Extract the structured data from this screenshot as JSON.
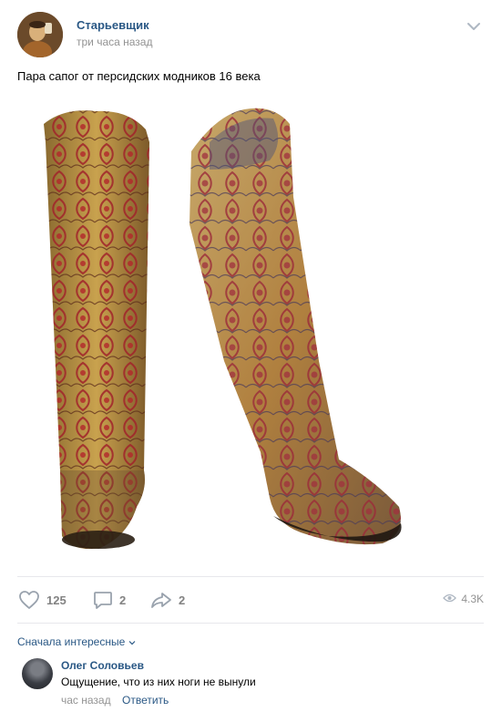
{
  "post": {
    "author": "Старьевщик",
    "time": "три часа назад",
    "text": "Пара сапог от персидских модников 16 века"
  },
  "actions": {
    "likes": "125",
    "comments": "2",
    "shares": "2",
    "views": "4.3K"
  },
  "comments_section": {
    "sort_label": "Сначала интересные"
  },
  "comment": {
    "author": "Олег Соловьев",
    "text": "Ощущение, что из них ноги не вынули",
    "time": "час назад",
    "reply_label": "Ответить"
  },
  "icons": {
    "menu": "chevron-down-icon",
    "like": "heart-icon",
    "comment": "comment-icon",
    "share": "share-icon",
    "views": "eye-icon"
  },
  "colors": {
    "link": "#2a5885",
    "muted": "#939393",
    "icon": "#99a2ad"
  }
}
